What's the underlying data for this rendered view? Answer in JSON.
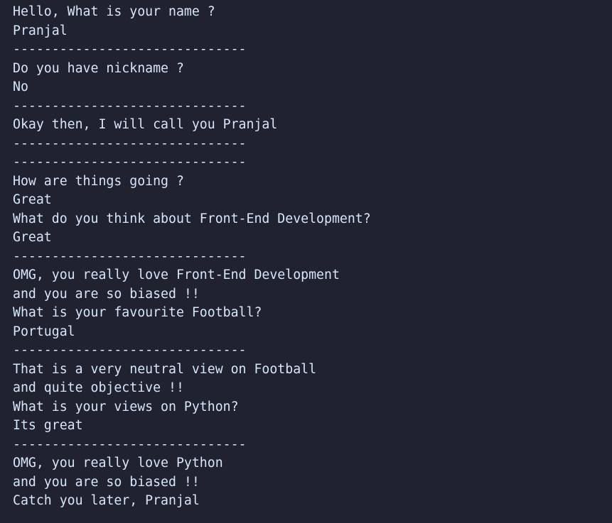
{
  "terminal": {
    "background": "#21222f",
    "text_color": "#d6e6fb",
    "lines": [
      "Hello, What is your name ?",
      "Pranjal",
      "------------------------------",
      "Do you have nickname ?",
      "No",
      "------------------------------",
      "Okay then, I will call you Pranjal",
      "------------------------------",
      "------------------------------",
      "How are things going ?",
      "Great",
      "What do you think about Front-End Development?",
      "Great",
      "------------------------------",
      "OMG, you really love Front-End Development",
      "and you are so biased !!",
      "What is your favourite Football?",
      "Portugal",
      "------------------------------",
      "That is a very neutral view on Football",
      "and quite objective !!",
      "What is your views on Python?",
      "Its great",
      "------------------------------",
      "OMG, you really love Python",
      "and you are so biased !!",
      "Catch you later, Pranjal"
    ]
  }
}
